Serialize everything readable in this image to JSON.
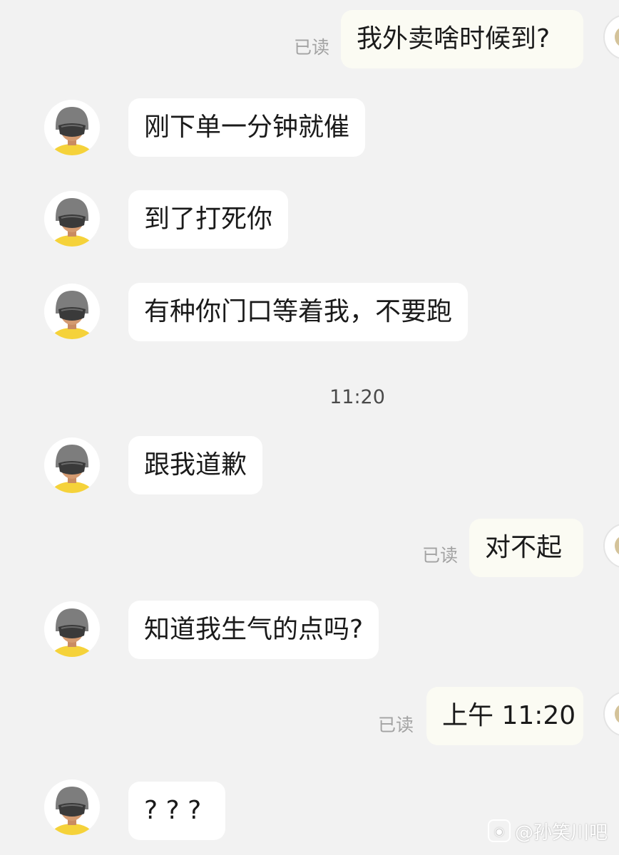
{
  "timestamp_divider": "11:20",
  "messages": [
    {
      "side": "right",
      "read": "已读",
      "text": "我外卖啥时候到?"
    },
    {
      "side": "left",
      "text": "刚下单一分钟就催"
    },
    {
      "side": "left",
      "text": "到了打死你"
    },
    {
      "side": "left",
      "text": "有种你门口等着我，不要跑"
    },
    {
      "side": "left",
      "text": "跟我道歉"
    },
    {
      "side": "right",
      "read": "已读",
      "text": "对不起"
    },
    {
      "side": "left",
      "text": "知道我生气的点吗?"
    },
    {
      "side": "right",
      "read": "已读",
      "text": "上午 11:20"
    },
    {
      "side": "left",
      "text": "? ? ?"
    }
  ],
  "watermark": {
    "text": "@孙笑川吧",
    "icon": "weibo-icon"
  },
  "colors": {
    "background": "#f2f2f2",
    "bubble": "#ffffff",
    "read_text": "#a3a3a3",
    "shirt": "#f5d23a"
  }
}
